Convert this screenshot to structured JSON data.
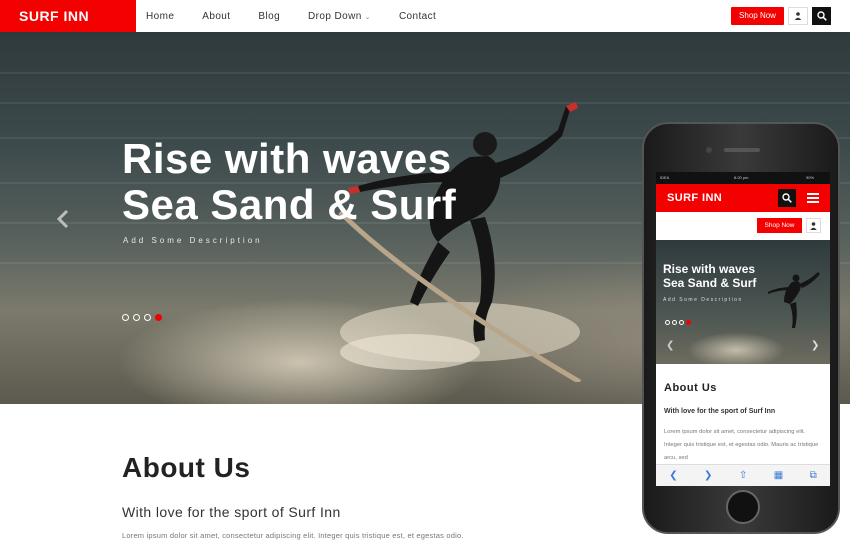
{
  "nav": {
    "brand": "SURF INN",
    "items": [
      {
        "label": "Home"
      },
      {
        "label": "About"
      },
      {
        "label": "Blog"
      },
      {
        "label": "Drop Down"
      },
      {
        "label": "Contact"
      }
    ],
    "shop_label": "Shop Now"
  },
  "hero": {
    "title_line1": "Rise with waves",
    "title_line2": "Sea Sand & Surf",
    "subtitle": "Add Some Description",
    "slides": 4,
    "active_slide": 4
  },
  "about": {
    "title": "About Us",
    "subtitle": "With love for the sport of Surf Inn",
    "text": "Lorem ipsum dolor sit amet, consectetur adipiscing elit. Integer quis tristique est, et egestas odio."
  },
  "phone": {
    "status": {
      "carrier": "IDEA",
      "time": "8:20 pm",
      "battery": "90%"
    },
    "brand": "SURF INN",
    "shop_label": "Shop Now",
    "title_line1": "Rise with waves",
    "title_line2": "Sea Sand & Surf",
    "subtitle": "Add Some Description",
    "about_title": "About Us",
    "about_subtitle": "With love for the sport of Surf Inn",
    "about_text": "Lorem ipsum dolor sit amet, consectetur adipiscing elit. Integer quis tristique est, et egestas odio. Mauris ac tristique arcu, sed"
  },
  "colors": {
    "accent": "#f30000",
    "dark": "#111111"
  }
}
